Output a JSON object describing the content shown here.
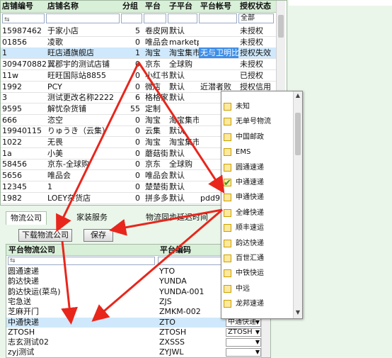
{
  "main_grid": {
    "columns": [
      "店铺编号",
      "店铺名称",
      "分组",
      "平台",
      "子平台",
      "平台帐号",
      "授权状态"
    ],
    "filter_status": "全部",
    "rows": [
      [
        "15987462",
        "于家小店",
        "5",
        "卷皮网",
        "默认",
        "",
        "未授权"
      ],
      [
        "01856",
        "凌歌",
        "0",
        "唯品会",
        "marketplace",
        "",
        "未授权"
      ],
      [
        "1",
        "旺店通旗舰店",
        "1",
        "淘宝",
        "淘宝集市",
        "无与卫明比",
        "授权失效"
      ],
      [
        "309470882",
        "翼郡宇的测试店铺",
        "0",
        "京东",
        "全球购",
        "",
        "未授权"
      ],
      [
        "11w",
        "旺旺国际站8855",
        "0",
        "小红书",
        "默认",
        "",
        "已授权"
      ],
      [
        "1992",
        "PCY",
        "0",
        "微店",
        "默认",
        "近潜者败",
        "授权信用"
      ],
      [
        "3",
        "测试更改名称2222",
        "6",
        "格格家",
        "默认",
        "",
        ""
      ],
      [
        "9595",
        "解忧杂货铺",
        "55",
        "定制",
        "",
        "",
        ""
      ],
      [
        "666",
        "恣空",
        "0",
        "淘宝",
        "淘宝集市",
        "",
        ""
      ],
      [
        "19940115",
        "りゅうき（云集）",
        "0",
        "云集",
        "默认",
        "",
        ""
      ],
      [
        "1022",
        "无畏",
        "0",
        "淘宝",
        "淘宝集市",
        "",
        ""
      ],
      [
        "1a",
        "小美",
        "0",
        "蘑菇街",
        "默认",
        "",
        ""
      ],
      [
        "58456",
        "京东-全球购",
        "0",
        "京东",
        "全球购",
        "",
        ""
      ],
      [
        "5656",
        "唯品会",
        "0",
        "唯品会",
        "默认",
        "",
        ""
      ],
      [
        "12345",
        "1",
        "0",
        "楚楚街",
        "默认",
        "",
        ""
      ],
      [
        "1982",
        "LOEY杂货店",
        "0",
        "拼多多",
        "默认",
        "pdd9",
        "未授权"
      ]
    ]
  },
  "tabs": [
    "物流公司",
    "家装服务",
    "物流同步延迟时间"
  ],
  "buttons": {
    "download": "下载物流公司",
    "save": "保存"
  },
  "bottom_grid": {
    "columns": [
      "平台物流公司",
      "平台编码"
    ],
    "rows": [
      {
        "name": "圆通速递",
        "code": "YTO",
        "select": ""
      },
      {
        "name": "韵达快递",
        "code": "YUNDA",
        "select": ""
      },
      {
        "name": "韵达快运(菜鸟)",
        "code": "YUNDA-001",
        "select": ""
      },
      {
        "name": "宅急送",
        "code": "ZJS",
        "select": ""
      },
      {
        "name": "芝麻开门",
        "code": "ZMKM-002",
        "select": ""
      },
      {
        "name": "中通快递",
        "code": "ZTO",
        "select": "中通快递"
      },
      {
        "name": "ZTOSH",
        "code": "ZTOSH",
        "select": "ZTOSH"
      },
      {
        "name": "志玄测试02",
        "code": "ZXSSS",
        "select": ""
      },
      {
        "name": "zyj测试",
        "code": "ZYJWL",
        "select": ""
      }
    ]
  },
  "popup": {
    "items": [
      {
        "label": "未知",
        "checked": false
      },
      {
        "label": "无单号物流",
        "checked": false
      },
      {
        "label": "中国邮政",
        "checked": false
      },
      {
        "label": "EMS",
        "checked": false
      },
      {
        "label": "圆通速递",
        "checked": false
      },
      {
        "label": "中通速递",
        "checked": true
      },
      {
        "label": "申通快递",
        "checked": false
      },
      {
        "label": "全峰快递",
        "checked": false
      },
      {
        "label": "顺丰速运",
        "checked": false
      },
      {
        "label": "韵达快递",
        "checked": false
      },
      {
        "label": "百世汇通",
        "checked": false
      },
      {
        "label": "中铁快运",
        "checked": false
      },
      {
        "label": "中远",
        "checked": false
      },
      {
        "label": "龙邦速递",
        "checked": false
      }
    ]
  },
  "colors": {
    "selected_row": "#cfe8fb",
    "highlight": "#3e8ee8",
    "header": "#d8efd8",
    "arrow": "#e8261c"
  }
}
